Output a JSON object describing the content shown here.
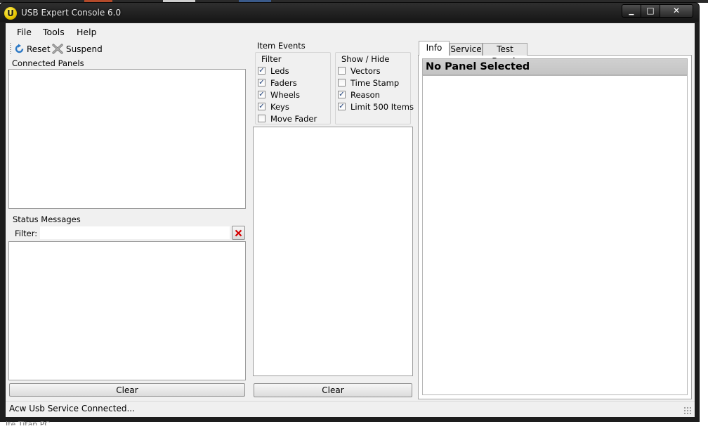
{
  "window": {
    "title": "USB Expert Console 6.0",
    "app_icon_letter": "U",
    "minimize_glyph": "▁",
    "maximize_glyph": "□",
    "close_glyph": "✕"
  },
  "menu": {
    "items": [
      {
        "label": "File"
      },
      {
        "label": "Tools"
      },
      {
        "label": "Help"
      }
    ]
  },
  "toolbar": {
    "reset_label": "Reset",
    "reset_icon": "refresh-icon",
    "suspend_label": "Suspend",
    "suspend_icon": "suspend-x-icon"
  },
  "connected_panels": {
    "label": "Connected Panels"
  },
  "status_messages": {
    "label": "Status Messages",
    "filter_label": "Filter:",
    "filter_value": "",
    "clear_filter_icon": "red-x-icon",
    "clear_label": "Clear"
  },
  "item_events": {
    "label": "Item Events",
    "filter_group": {
      "label": "Filter",
      "options": [
        {
          "label": "Leds",
          "checked": true
        },
        {
          "label": "Faders",
          "checked": true
        },
        {
          "label": "Wheels",
          "checked": true
        },
        {
          "label": "Keys",
          "checked": true
        },
        {
          "label": "Move Fader",
          "checked": false
        }
      ]
    },
    "show_hide_group": {
      "label": "Show / Hide",
      "options": [
        {
          "label": "Vectors",
          "checked": false
        },
        {
          "label": "Time Stamp",
          "checked": false
        },
        {
          "label": "Reason",
          "checked": true
        },
        {
          "label": "Limit 500 Items",
          "checked": true
        }
      ]
    },
    "clear_label": "Clear"
  },
  "tabs": [
    {
      "label": "Info",
      "active": true
    },
    {
      "label": "Service",
      "active": false
    },
    {
      "label": "Test Bench",
      "active": false
    }
  ],
  "info": {
    "header": "No Panel Selected"
  },
  "status_bar": {
    "text": "Acw Usb Service Connected..."
  },
  "desktop": {
    "below_text": "Ite Titan PC"
  },
  "colors": {
    "frame": "#1d1d1d",
    "client": "#f0f0f0",
    "header_bar": "#c8c8c8",
    "checkmark": "#1e3f7a",
    "red_x": "#d40000"
  }
}
